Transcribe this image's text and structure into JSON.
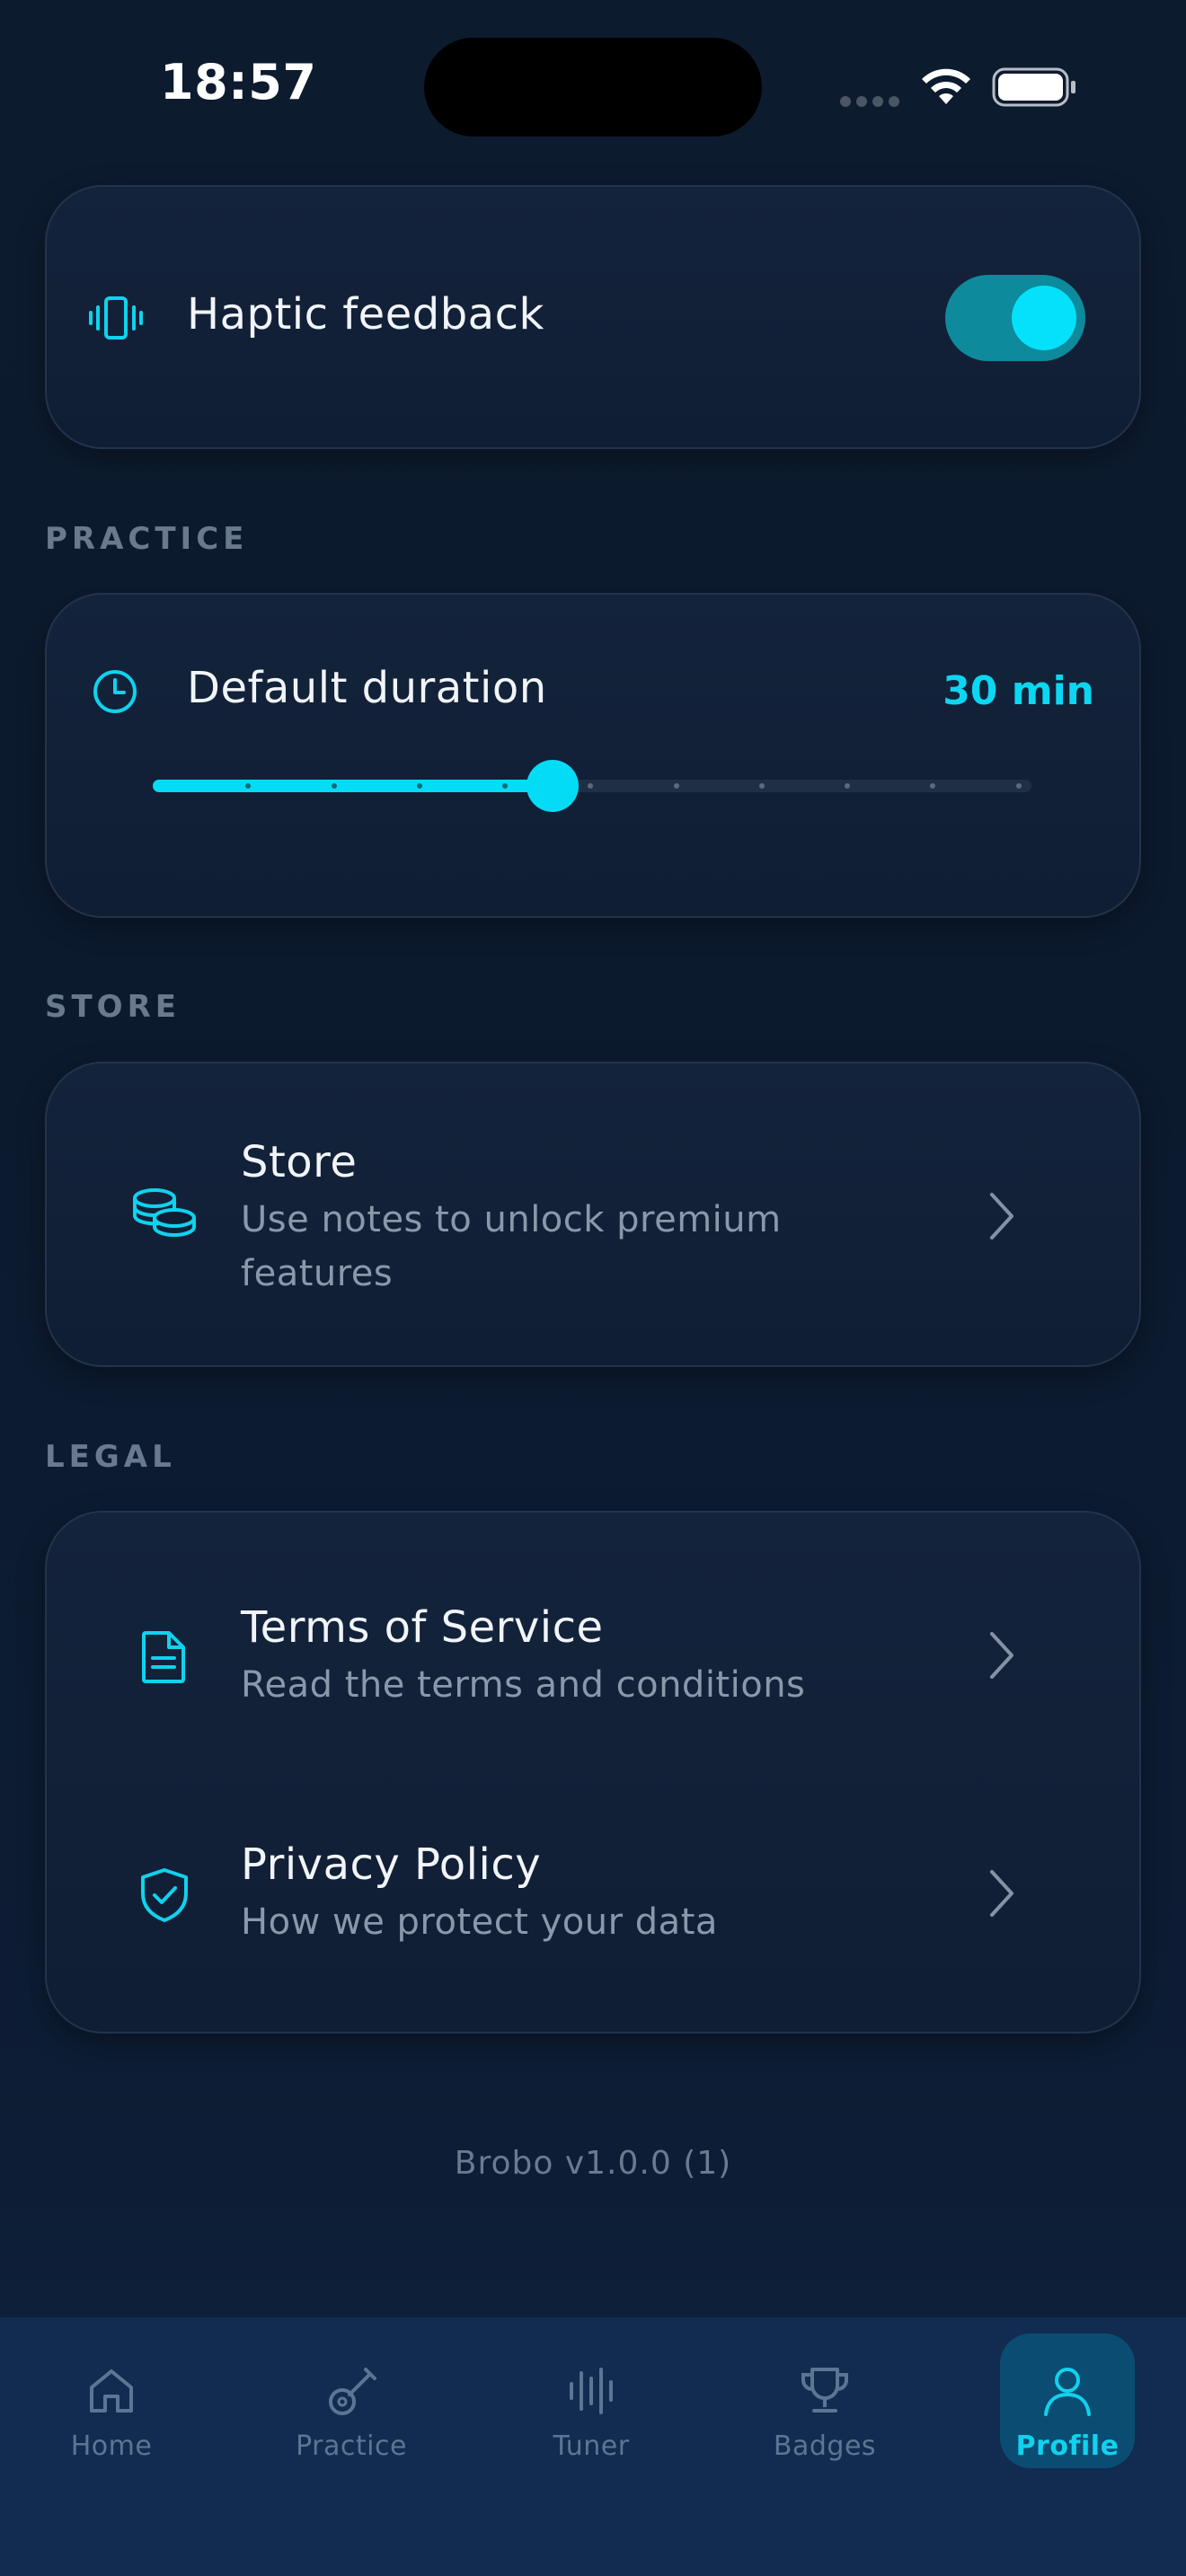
{
  "status_bar": {
    "time": "18:57"
  },
  "haptic": {
    "label": "Haptic feedback",
    "enabled": true
  },
  "practice": {
    "section_label": "PRACTICE",
    "duration_label": "Default duration",
    "duration_value": "30 min",
    "slider_fraction": 0.4545,
    "slider_steps": 12
  },
  "store": {
    "section_label": "STORE",
    "title": "Store",
    "subtitle_line1": "Use notes to unlock premium",
    "subtitle_line2": "features"
  },
  "legal": {
    "section_label": "LEGAL",
    "items": [
      {
        "title": "Terms of Service",
        "subtitle": "Read the terms and conditions"
      },
      {
        "title": "Privacy Policy",
        "subtitle": "How we protect your data"
      }
    ]
  },
  "version": "Brobo v1.0.0 (1)",
  "tabs": [
    {
      "label": "Home",
      "icon": "home-icon",
      "active": false
    },
    {
      "label": "Practice",
      "icon": "guitar-icon",
      "active": false
    },
    {
      "label": "Tuner",
      "icon": "waveform-icon",
      "active": false
    },
    {
      "label": "Badges",
      "icon": "trophy-icon",
      "active": false
    },
    {
      "label": "Profile",
      "icon": "person-icon",
      "active": true
    }
  ],
  "colors": {
    "accent": "#04dcf6",
    "background": "#0d1b2f",
    "card": "#13233b",
    "tab_bar": "#112c50",
    "muted_text": "#8a98aa"
  }
}
